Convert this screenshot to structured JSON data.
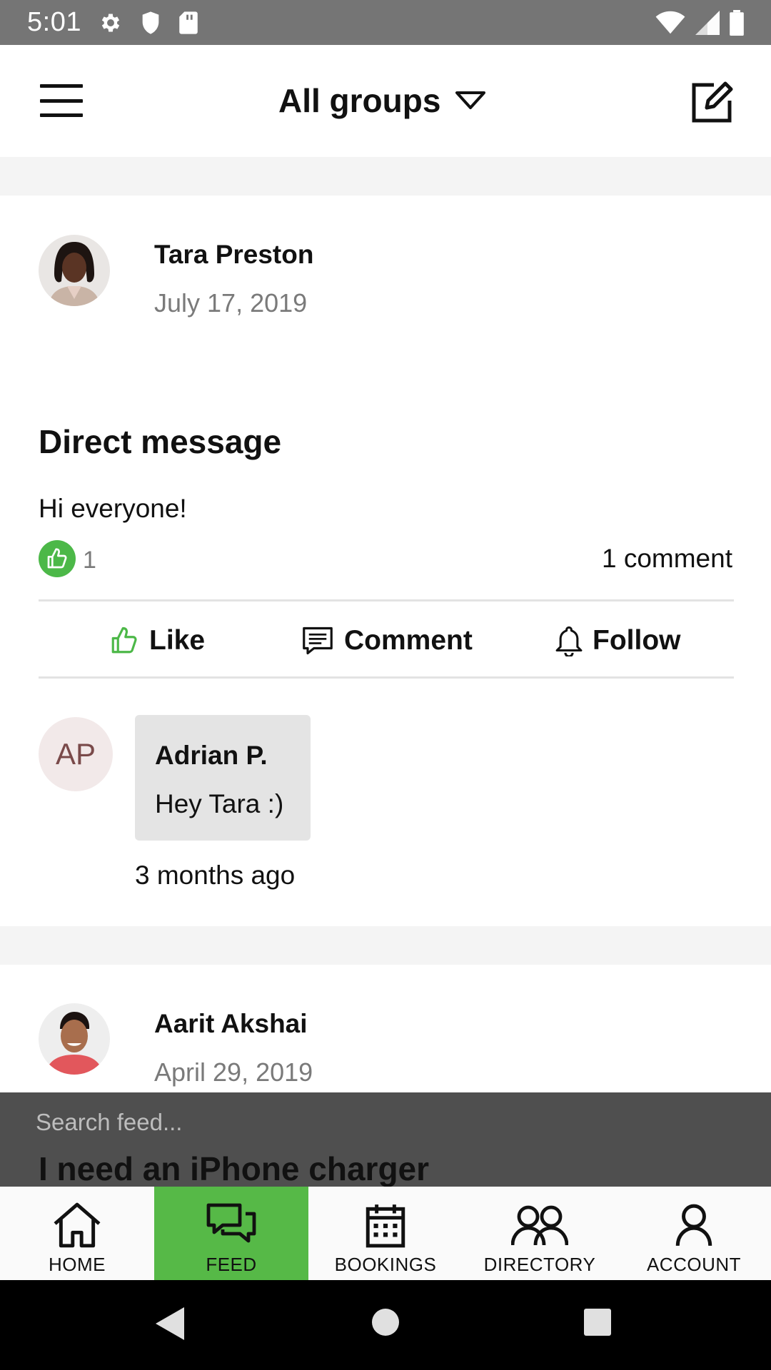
{
  "status_bar": {
    "time": "5:01"
  },
  "app_bar": {
    "title": "All groups"
  },
  "posts": [
    {
      "author": "Tara Preston",
      "date": "July 17, 2019",
      "title": "Direct message",
      "body": "Hi everyone!",
      "like_count": "1",
      "comment_count": "1 comment",
      "actions": {
        "like": "Like",
        "comment": "Comment",
        "follow": "Follow"
      },
      "comment": {
        "initials": "AP",
        "author": "Adrian P.",
        "text": "Hey Tara :)",
        "time": "3 months ago"
      }
    },
    {
      "author": "Aarit Akshai",
      "date": "April 29, 2019",
      "title": "I need an iPhone charger"
    }
  ],
  "search": {
    "placeholder": "Search feed..."
  },
  "bottom_nav": [
    {
      "label": "HOME",
      "icon": "home-icon",
      "active": false
    },
    {
      "label": "FEED",
      "icon": "chat-icon",
      "active": true
    },
    {
      "label": "BOOKINGS",
      "icon": "calendar-icon",
      "active": false
    },
    {
      "label": "DIRECTORY",
      "icon": "people-icon",
      "active": false
    },
    {
      "label": "ACCOUNT",
      "icon": "person-icon",
      "active": false
    }
  ],
  "colors": {
    "accent": "#4cb848",
    "status_bar": "#757575",
    "search_overlay": "#4f4f4f"
  }
}
